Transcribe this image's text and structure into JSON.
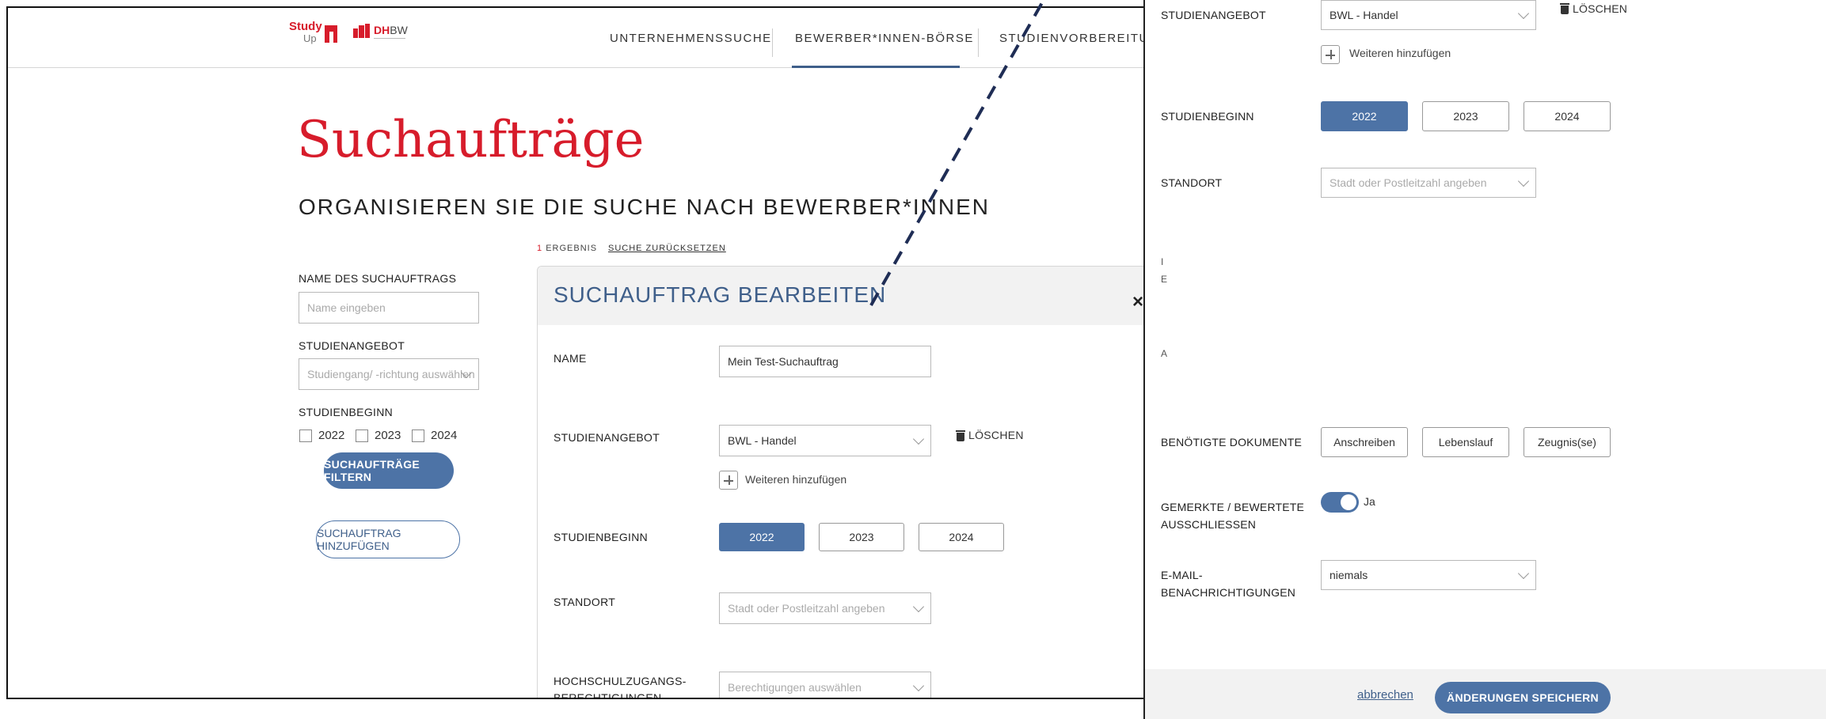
{
  "nav": {
    "logo_study": "Study",
    "logo_up": "Up",
    "logo_dh": "DH",
    "logo_bw": "BW",
    "items": [
      "UNTERNEHMENSSUCHE",
      "BEWERBER*INNEN-BÖRSE",
      "STUDIENVORBEREITUNG"
    ]
  },
  "page": {
    "title": "Suchaufträge",
    "subtitle": "ORGANISIEREN SIE DIE SUCHE NACH BEWERBER*INNEN"
  },
  "filter": {
    "name_label": "NAME DES SUCHAUFTRAGS",
    "name_placeholder": "Name eingeben",
    "studienangebot_label": "STUDIENANGEBOT",
    "studienangebot_placeholder": "Studiengang/ -richtung auswählen",
    "studienbeginn_label": "STUDIENBEGINN",
    "years": [
      "2022",
      "2023",
      "2024"
    ],
    "filter_button": "SUCHAUFTRÄGE FILTERN",
    "add_button": "SUCHAUFTRAG HINZUFÜGEN"
  },
  "results": {
    "count": "1",
    "count_label": "ERGEBNIS",
    "reset": "SUCHE ZURÜCKSETZEN"
  },
  "modal": {
    "title": "SUCHAUFTRAG BEARBEITEN",
    "close": "×",
    "name_label": "NAME",
    "name_value": "Mein Test-Suchauftrag",
    "studienangebot_label": "STUDIENANGEBOT",
    "studienangebot_value": "BWL - Handel",
    "delete_label": "LÖSCHEN",
    "add_more": "Weiteren hinzufügen",
    "studienbeginn_label": "STUDIENBEGINN",
    "years": [
      "2022",
      "2023",
      "2024"
    ],
    "selected_year": "2022",
    "standort_label": "STANDORT",
    "standort_placeholder": "Stadt oder Postleitzahl angeben",
    "hzb_label": "HOCHSCHULZUGANGS-",
    "hzb_label2": "BERECHTIGUNGEN",
    "hzb_placeholder": "Berechtigungen auswählen"
  },
  "right_panel": {
    "studienangebot_label": "STUDIENANGEBOT",
    "studienangebot_value": "BWL - Handel",
    "delete_label": "LÖSCHEN",
    "add_more": "Weiteren hinzufügen",
    "studienbeginn_label": "STUDIENBEGINN",
    "years": [
      "2022",
      "2023",
      "2024"
    ],
    "standort_label": "STANDORT",
    "standort_placeholder": "Stadt oder Postleitzahl angeben",
    "cut_label_1a": "I",
    "cut_label_1b": "E",
    "cut_label_2": "A",
    "dokumente_label": "BENÖTIGTE DOKUMENTE",
    "dokumente": [
      "Anschreiben",
      "Lebenslauf",
      "Zeugnis(se)"
    ],
    "gemerkte_label_1": "GEMERKTE / BEWERTETE",
    "gemerkte_label_2": "AUSSCHLIESSEN",
    "toggle_value": "Ja",
    "email_label_1": "E-MAIL-",
    "email_label_2": "BENACHRICHTIGUNGEN",
    "email_value": "niemals",
    "cancel": "abbrechen",
    "save": "ÄNDERUNGEN SPEICHERN"
  },
  "colors": {
    "brand_red": "#d71c2b",
    "primary_blue": "#4d73a6",
    "title_blue": "#3f5f8a"
  }
}
